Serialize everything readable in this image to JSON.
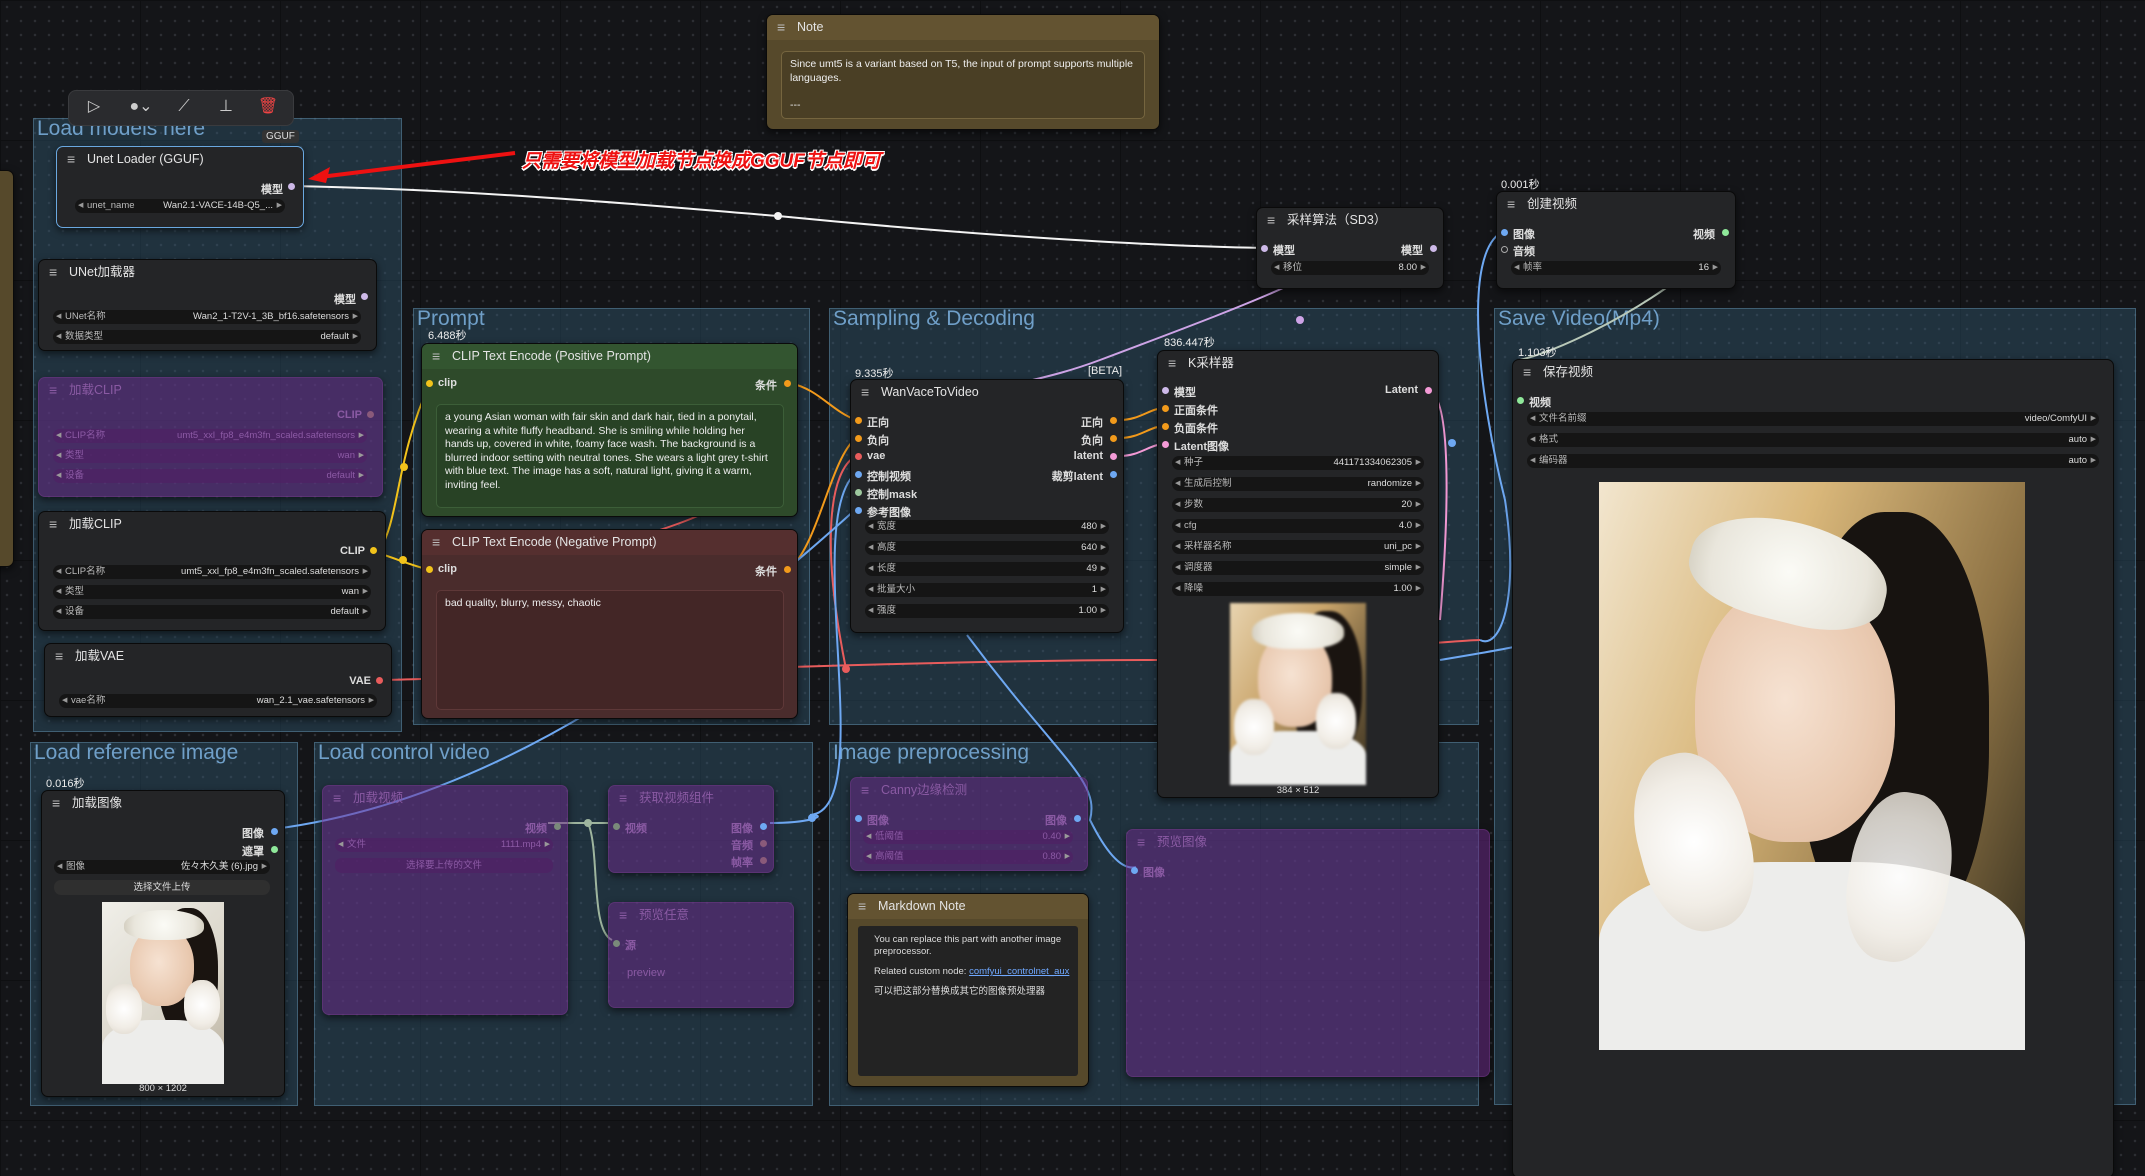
{
  "annotation_text": "只需要将模型加载节点换成GGUF节点即可",
  "toolbar": {
    "badge": "GGUF"
  },
  "groups": {
    "load_models": "Load models here",
    "prompt": "Prompt",
    "sampling": "Sampling & Decoding",
    "save_video": "Save Video(Mp4)",
    "load_ref": "Load reference image",
    "load_control": "Load control video",
    "preprocess": "Image preprocessing"
  },
  "note": {
    "title": "Note",
    "text": "Since umt5 is a variant based on T5, the input of prompt supports multiple languages.",
    "sep": "---"
  },
  "unet_gguf": {
    "title": "Unet Loader (GGUF)",
    "out": "模型",
    "w_label": "unet_name",
    "w_value": "Wan2.1-VACE-14B-Q5_..."
  },
  "unet_loader": {
    "title": "UNet加载器",
    "out": "模型",
    "w1_label": "UNet名称",
    "w1_value": "Wan2_1-T2V-1_3B_bf16.safetensors",
    "w2_label": "数据类型",
    "w2_value": "default"
  },
  "clip_bypass": {
    "title": "加载CLIP",
    "out": "CLIP",
    "w1_label": "CLIP名称",
    "w1_value": "umt5_xxl_fp8_e4m3fn_scaled.safetensors",
    "w2_label": "类型",
    "w2_value": "wan",
    "w3_label": "设备",
    "w3_value": "default"
  },
  "clip_loader": {
    "title": "加载CLIP",
    "out": "CLIP",
    "w1_label": "CLIP名称",
    "w1_value": "umt5_xxl_fp8_e4m3fn_scaled.safetensors",
    "w2_label": "类型",
    "w2_value": "wan",
    "w3_label": "设备",
    "w3_value": "default"
  },
  "vae_loader": {
    "title": "加载VAE",
    "out": "VAE",
    "w_label": "vae名称",
    "w_value": "wan_2.1_vae.safetensors"
  },
  "pos_prompt": {
    "timing": "6.488秒",
    "title": "CLIP Text Encode (Positive Prompt)",
    "in": "clip",
    "out": "条件",
    "text": "a young Asian woman with fair skin and dark hair, tied in a ponytail, wearing a white fluffy headband. She is smiling while holding her hands up, covered in white, foamy face wash. The background is a blurred indoor setting with neutral tones. She wears a light grey t-shirt with blue text. The image has a soft, natural light, giving it a warm, inviting feel."
  },
  "neg_prompt": {
    "title": "CLIP Text Encode (Negative Prompt)",
    "in": "clip",
    "out": "条件",
    "text": "bad quality, blurry, messy, chaotic"
  },
  "wan_vace": {
    "timing": "9.335秒",
    "beta": "[BETA]",
    "title": "WanVaceToVideo",
    "in1": "正向",
    "in2": "负向",
    "in3": "vae",
    "in4": "控制视频",
    "in5": "控制mask",
    "in6": "参考图像",
    "out1": "正向",
    "out2": "负向",
    "out3": "latent",
    "out4": "裁剪latent",
    "widgets": [
      {
        "l": "宽度",
        "v": "480"
      },
      {
        "l": "高度",
        "v": "640"
      },
      {
        "l": "长度",
        "v": "49"
      },
      {
        "l": "批量大小",
        "v": "1"
      },
      {
        "l": "强度",
        "v": "1.00"
      }
    ]
  },
  "ksampler": {
    "timing": "836.447秒",
    "title": "K采样器",
    "in1": "模型",
    "in2": "正面条件",
    "in3": "负面条件",
    "in4": "Latent图像",
    "out": "Latent",
    "widgets": [
      {
        "l": "种子",
        "v": "441171334062305"
      },
      {
        "l": "生成后控制",
        "v": "randomize"
      },
      {
        "l": "步数",
        "v": "20"
      },
      {
        "l": "cfg",
        "v": "4.0"
      },
      {
        "l": "采样器名称",
        "v": "uni_pc"
      },
      {
        "l": "调度器",
        "v": "simple"
      },
      {
        "l": "降噪",
        "v": "1.00"
      }
    ],
    "img_caption": "384 × 512"
  },
  "sampling_algo": {
    "title": "采样算法（SD3）",
    "in": "模型",
    "out": "模型",
    "w_label": "移位",
    "w_value": "8.00"
  },
  "create_video": {
    "timing": "0.001秒",
    "title": "创建视频",
    "in1": "图像",
    "in2": "音频",
    "out": "视频",
    "w_label": "帧率",
    "w_value": "16"
  },
  "save_video": {
    "timing": "1.103秒",
    "title": "保存视频",
    "in": "视频",
    "w1_label": "文件名前缀",
    "w1_value": "video/ComfyUI",
    "w2_label": "格式",
    "w2_value": "auto",
    "w3_label": "编码器",
    "w3_value": "auto"
  },
  "load_image": {
    "timing": "0.016秒",
    "title": "加载图像",
    "out1": "图像",
    "out2": "遮罩",
    "w_label": "图像",
    "w_value": "佐々木久美 (6).jpg",
    "upload": "选择文件上传",
    "img_caption": "800 × 1202"
  },
  "load_video": {
    "title": "加载视频",
    "out": "视频",
    "w_label": "文件",
    "w_value": "1111.mp4",
    "upload": "选择要上传的文件"
  },
  "get_video_comp": {
    "title": "获取视频组件",
    "in": "视频",
    "out1": "图像",
    "out2": "音频",
    "out3": "帧率"
  },
  "preview_any": {
    "title": "预览任意",
    "in": "源",
    "text": "preview"
  },
  "canny": {
    "title": "Canny边缘检测",
    "in": "图像",
    "out": "图像",
    "w1_label": "低阈值",
    "w1_value": "0.40",
    "w2_label": "高阈值",
    "w2_value": "0.80"
  },
  "preview_image": {
    "title": "预览图像",
    "in": "图像"
  },
  "markdown_note": {
    "title": "Markdown Note",
    "line1": "You can replace this part with another image preprocessor.",
    "line2_prefix": "Related custom node: ",
    "line2_link": "comfyui_controlnet_aux",
    "line3": "可以把这部分替换成其它的图像预处理器"
  }
}
